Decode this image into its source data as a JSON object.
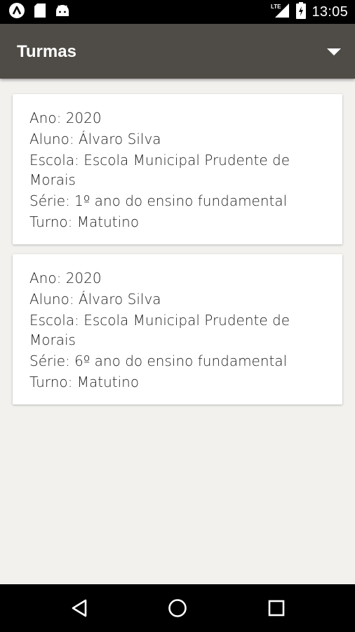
{
  "status_bar": {
    "time": "13:05",
    "network": "LTE",
    "icons": [
      "app-a-icon",
      "sd-card-icon",
      "android-icon",
      "signal-icon",
      "battery-icon"
    ]
  },
  "app_bar": {
    "title": "Turmas",
    "menu_icon": "dropdown-arrow-icon",
    "background": "#4f4c47"
  },
  "cards": [
    {
      "ano": "Ano: 2020",
      "aluno": "Aluno: Álvaro Silva",
      "escola": "Escola: Escola Municipal Prudente de Morais",
      "serie": "Série: 1º ano do ensino fundamental",
      "turno": "Turno: Matutino"
    },
    {
      "ano": "Ano: 2020",
      "aluno": "Aluno: Álvaro Silva",
      "escola": "Escola: Escola Municipal Prudente de Morais",
      "serie": "Série: 6º ano do ensino fundamental",
      "turno": "Turno: Matutino"
    }
  ],
  "nav_bar": {
    "icons": [
      "back-icon",
      "home-icon",
      "recents-icon"
    ]
  }
}
